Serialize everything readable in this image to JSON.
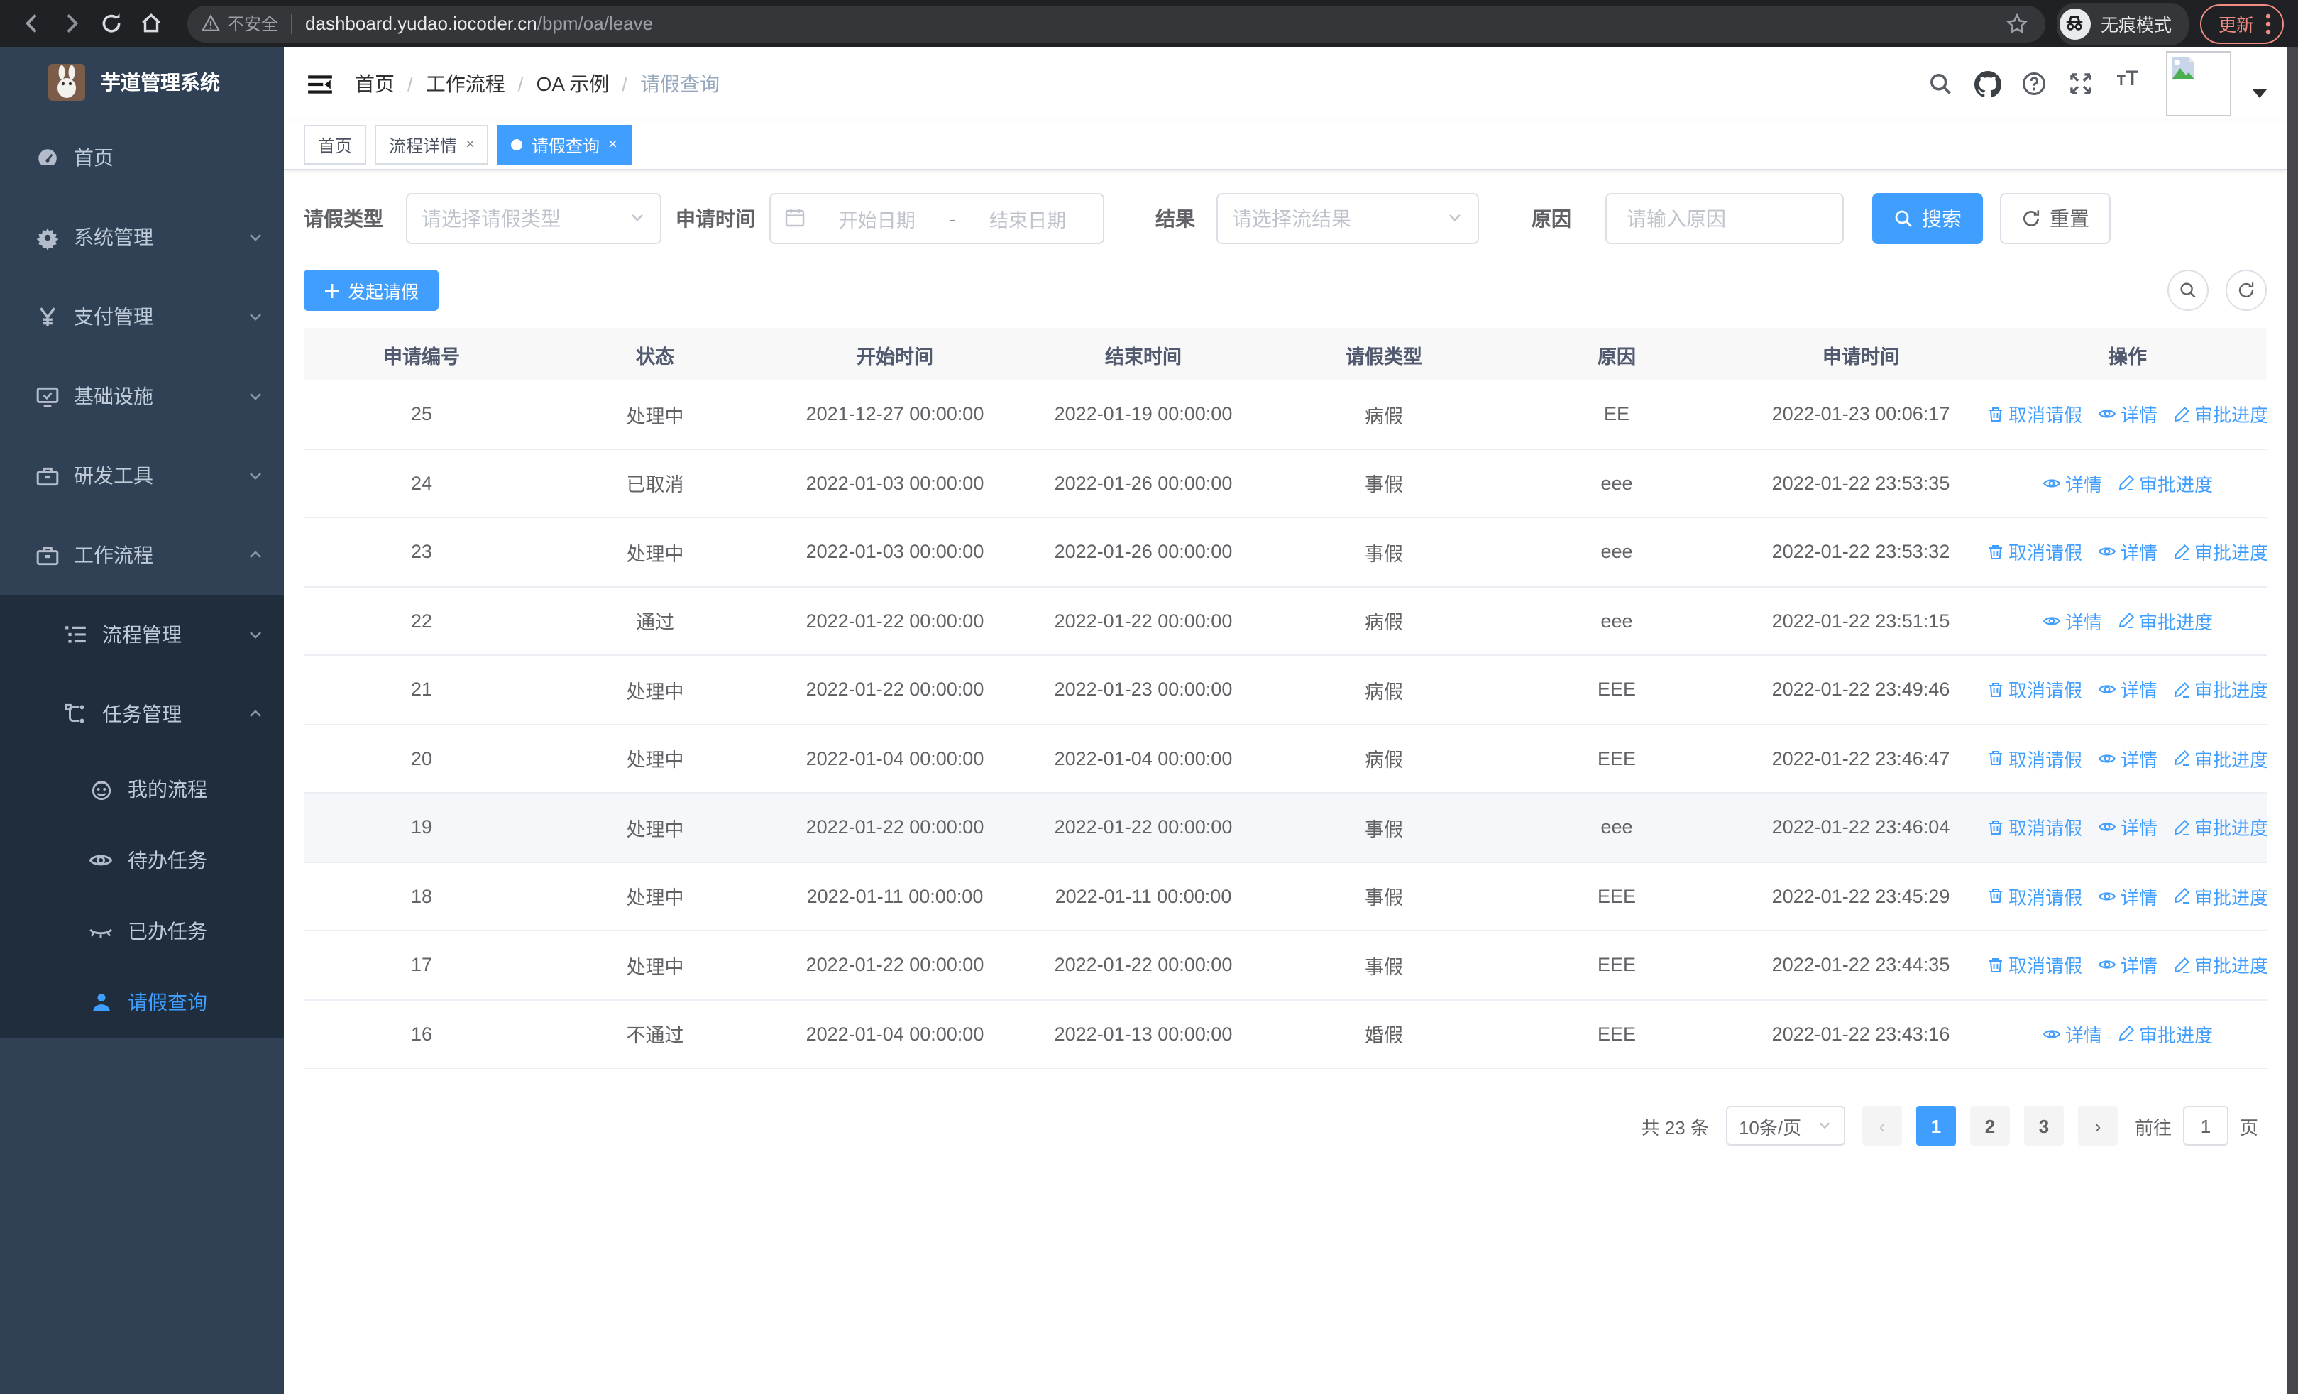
{
  "colors": {
    "accent": "#409eff",
    "sidebar_bg": "#304156",
    "submenu_bg": "#1f2d3d",
    "chrome_bg": "#202124",
    "update_accent": "#f28b82",
    "header_bg": "#f8f8f9"
  },
  "browser": {
    "security_label": "不安全",
    "url_host": "dashboard.yudao.iocoder.cn",
    "url_path": "/bpm/oa/leave",
    "incognito_label": "无痕模式",
    "update_label": "更新"
  },
  "app": {
    "title": "芋道管理系统"
  },
  "sidebar": {
    "items": [
      {
        "label": "首页"
      },
      {
        "label": "系统管理"
      },
      {
        "label": "支付管理"
      },
      {
        "label": "基础设施"
      },
      {
        "label": "研发工具"
      },
      {
        "label": "工作流程"
      },
      {
        "label": "流程管理"
      },
      {
        "label": "任务管理"
      },
      {
        "label": "我的流程"
      },
      {
        "label": "待办任务"
      },
      {
        "label": "已办任务"
      },
      {
        "label": "请假查询"
      }
    ]
  },
  "breadcrumb": {
    "items": [
      "首页",
      "工作流程",
      "OA 示例",
      "请假查询"
    ],
    "separator": "/"
  },
  "tabs": [
    {
      "label": "首页"
    },
    {
      "label": "流程详情",
      "close": "×"
    },
    {
      "label": "请假查询",
      "close": "×"
    }
  ],
  "filters": {
    "leave_type_label": "请假类型",
    "leave_type_placeholder": "请选择请假类型",
    "apply_time_label": "申请时间",
    "date_start_placeholder": "开始日期",
    "date_separator": "-",
    "date_end_placeholder": "结束日期",
    "result_label": "结果",
    "result_placeholder": "请选择流结果",
    "reason_label": "原因",
    "reason_placeholder": "请输入原因",
    "search_label": "搜索",
    "reset_label": "重置"
  },
  "toolbar": {
    "create_label": "发起请假"
  },
  "table": {
    "columns": [
      "申请编号",
      "状态",
      "开始时间",
      "结束时间",
      "请假类型",
      "原因",
      "申请时间",
      "操作"
    ],
    "rows": [
      {
        "id": "25",
        "status": "处理中",
        "start": "2021-12-27 00:00:00",
        "end": "2022-01-19 00:00:00",
        "type": "病假",
        "reason": "EE",
        "applied": "2022-01-23 00:06:17",
        "cancel": "取消请假",
        "detail": "详情",
        "progress": "审批进度"
      },
      {
        "id": "24",
        "status": "已取消",
        "start": "2022-01-03 00:00:00",
        "end": "2022-01-26 00:00:00",
        "type": "事假",
        "reason": "eee",
        "applied": "2022-01-22 23:53:35",
        "detail": "详情",
        "progress": "审批进度"
      },
      {
        "id": "23",
        "status": "处理中",
        "start": "2022-01-03 00:00:00",
        "end": "2022-01-26 00:00:00",
        "type": "事假",
        "reason": "eee",
        "applied": "2022-01-22 23:53:32",
        "cancel": "取消请假",
        "detail": "详情",
        "progress": "审批进度"
      },
      {
        "id": "22",
        "status": "通过",
        "start": "2022-01-22 00:00:00",
        "end": "2022-01-22 00:00:00",
        "type": "病假",
        "reason": "eee",
        "applied": "2022-01-22 23:51:15",
        "detail": "详情",
        "progress": "审批进度"
      },
      {
        "id": "21",
        "status": "处理中",
        "start": "2022-01-22 00:00:00",
        "end": "2022-01-23 00:00:00",
        "type": "病假",
        "reason": "EEE",
        "applied": "2022-01-22 23:49:46",
        "cancel": "取消请假",
        "detail": "详情",
        "progress": "审批进度"
      },
      {
        "id": "20",
        "status": "处理中",
        "start": "2022-01-04 00:00:00",
        "end": "2022-01-04 00:00:00",
        "type": "病假",
        "reason": "EEE",
        "applied": "2022-01-22 23:46:47",
        "cancel": "取消请假",
        "detail": "详情",
        "progress": "审批进度"
      },
      {
        "id": "19",
        "status": "处理中",
        "start": "2022-01-22 00:00:00",
        "end": "2022-01-22 00:00:00",
        "type": "事假",
        "reason": "eee",
        "applied": "2022-01-22 23:46:04",
        "cancel": "取消请假",
        "detail": "详情",
        "progress": "审批进度",
        "highlight": true
      },
      {
        "id": "18",
        "status": "处理中",
        "start": "2022-01-11 00:00:00",
        "end": "2022-01-11 00:00:00",
        "type": "事假",
        "reason": "EEE",
        "applied": "2022-01-22 23:45:29",
        "cancel": "取消请假",
        "detail": "详情",
        "progress": "审批进度"
      },
      {
        "id": "17",
        "status": "处理中",
        "start": "2022-01-22 00:00:00",
        "end": "2022-01-22 00:00:00",
        "type": "事假",
        "reason": "EEE",
        "applied": "2022-01-22 23:44:35",
        "cancel": "取消请假",
        "detail": "详情",
        "progress": "审批进度"
      },
      {
        "id": "16",
        "status": "不通过",
        "start": "2022-01-04 00:00:00",
        "end": "2022-01-13 00:00:00",
        "type": "婚假",
        "reason": "EEE",
        "applied": "2022-01-22 23:43:16",
        "detail": "详情",
        "progress": "审批进度"
      }
    ]
  },
  "pagination": {
    "total": "共 23 条",
    "page_size": "10条/页",
    "prev": "‹",
    "next": "›",
    "pages": [
      "1",
      "2",
      "3"
    ],
    "goto_label": "前往",
    "goto_value": "1",
    "goto_suffix": "页"
  }
}
